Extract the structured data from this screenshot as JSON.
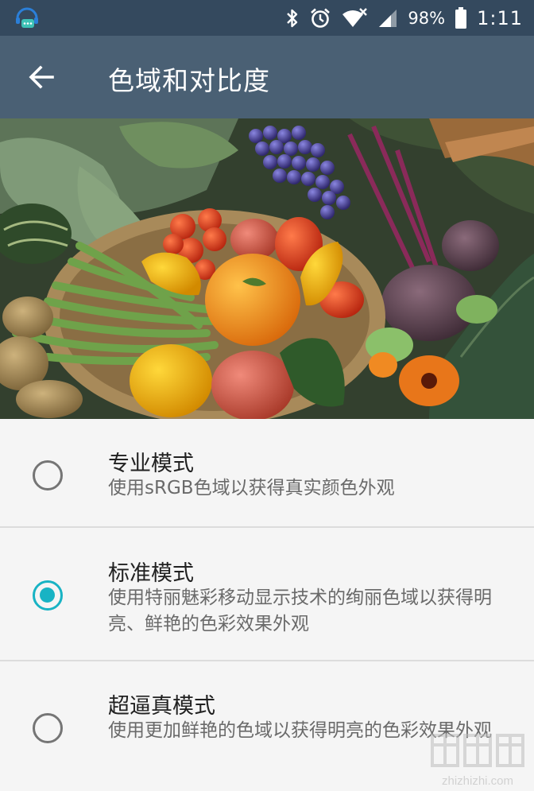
{
  "status_bar": {
    "battery": "98%",
    "time": "1:11",
    "icons": [
      "assistant-icon",
      "bluetooth-icon",
      "alarm-icon",
      "wifi-icon",
      "signal-icon",
      "battery-icon"
    ]
  },
  "app_bar": {
    "title": "色域和对比度",
    "back_icon": "arrow-left-icon"
  },
  "hero_image": {
    "subject": "vegetable-basket"
  },
  "options": [
    {
      "title": "专业模式",
      "desc": "使用sRGB色域以获得真实颜色外观",
      "selected": false
    },
    {
      "title": "标准模式",
      "desc": "使用特丽魅彩移动显示技术的绚丽色域以获得明亮、鲜艳的色彩效果外观",
      "selected": true
    },
    {
      "title": "超逼真模式",
      "desc": "使用更加鲜艳的色域以获得明亮的色彩效果外观",
      "selected": false
    }
  ],
  "watermark": {
    "text": "zhizhizhi.com"
  },
  "colors": {
    "status_bar": "#34495e",
    "app_bar": "#4a6074",
    "accent": "#18b3c4"
  }
}
